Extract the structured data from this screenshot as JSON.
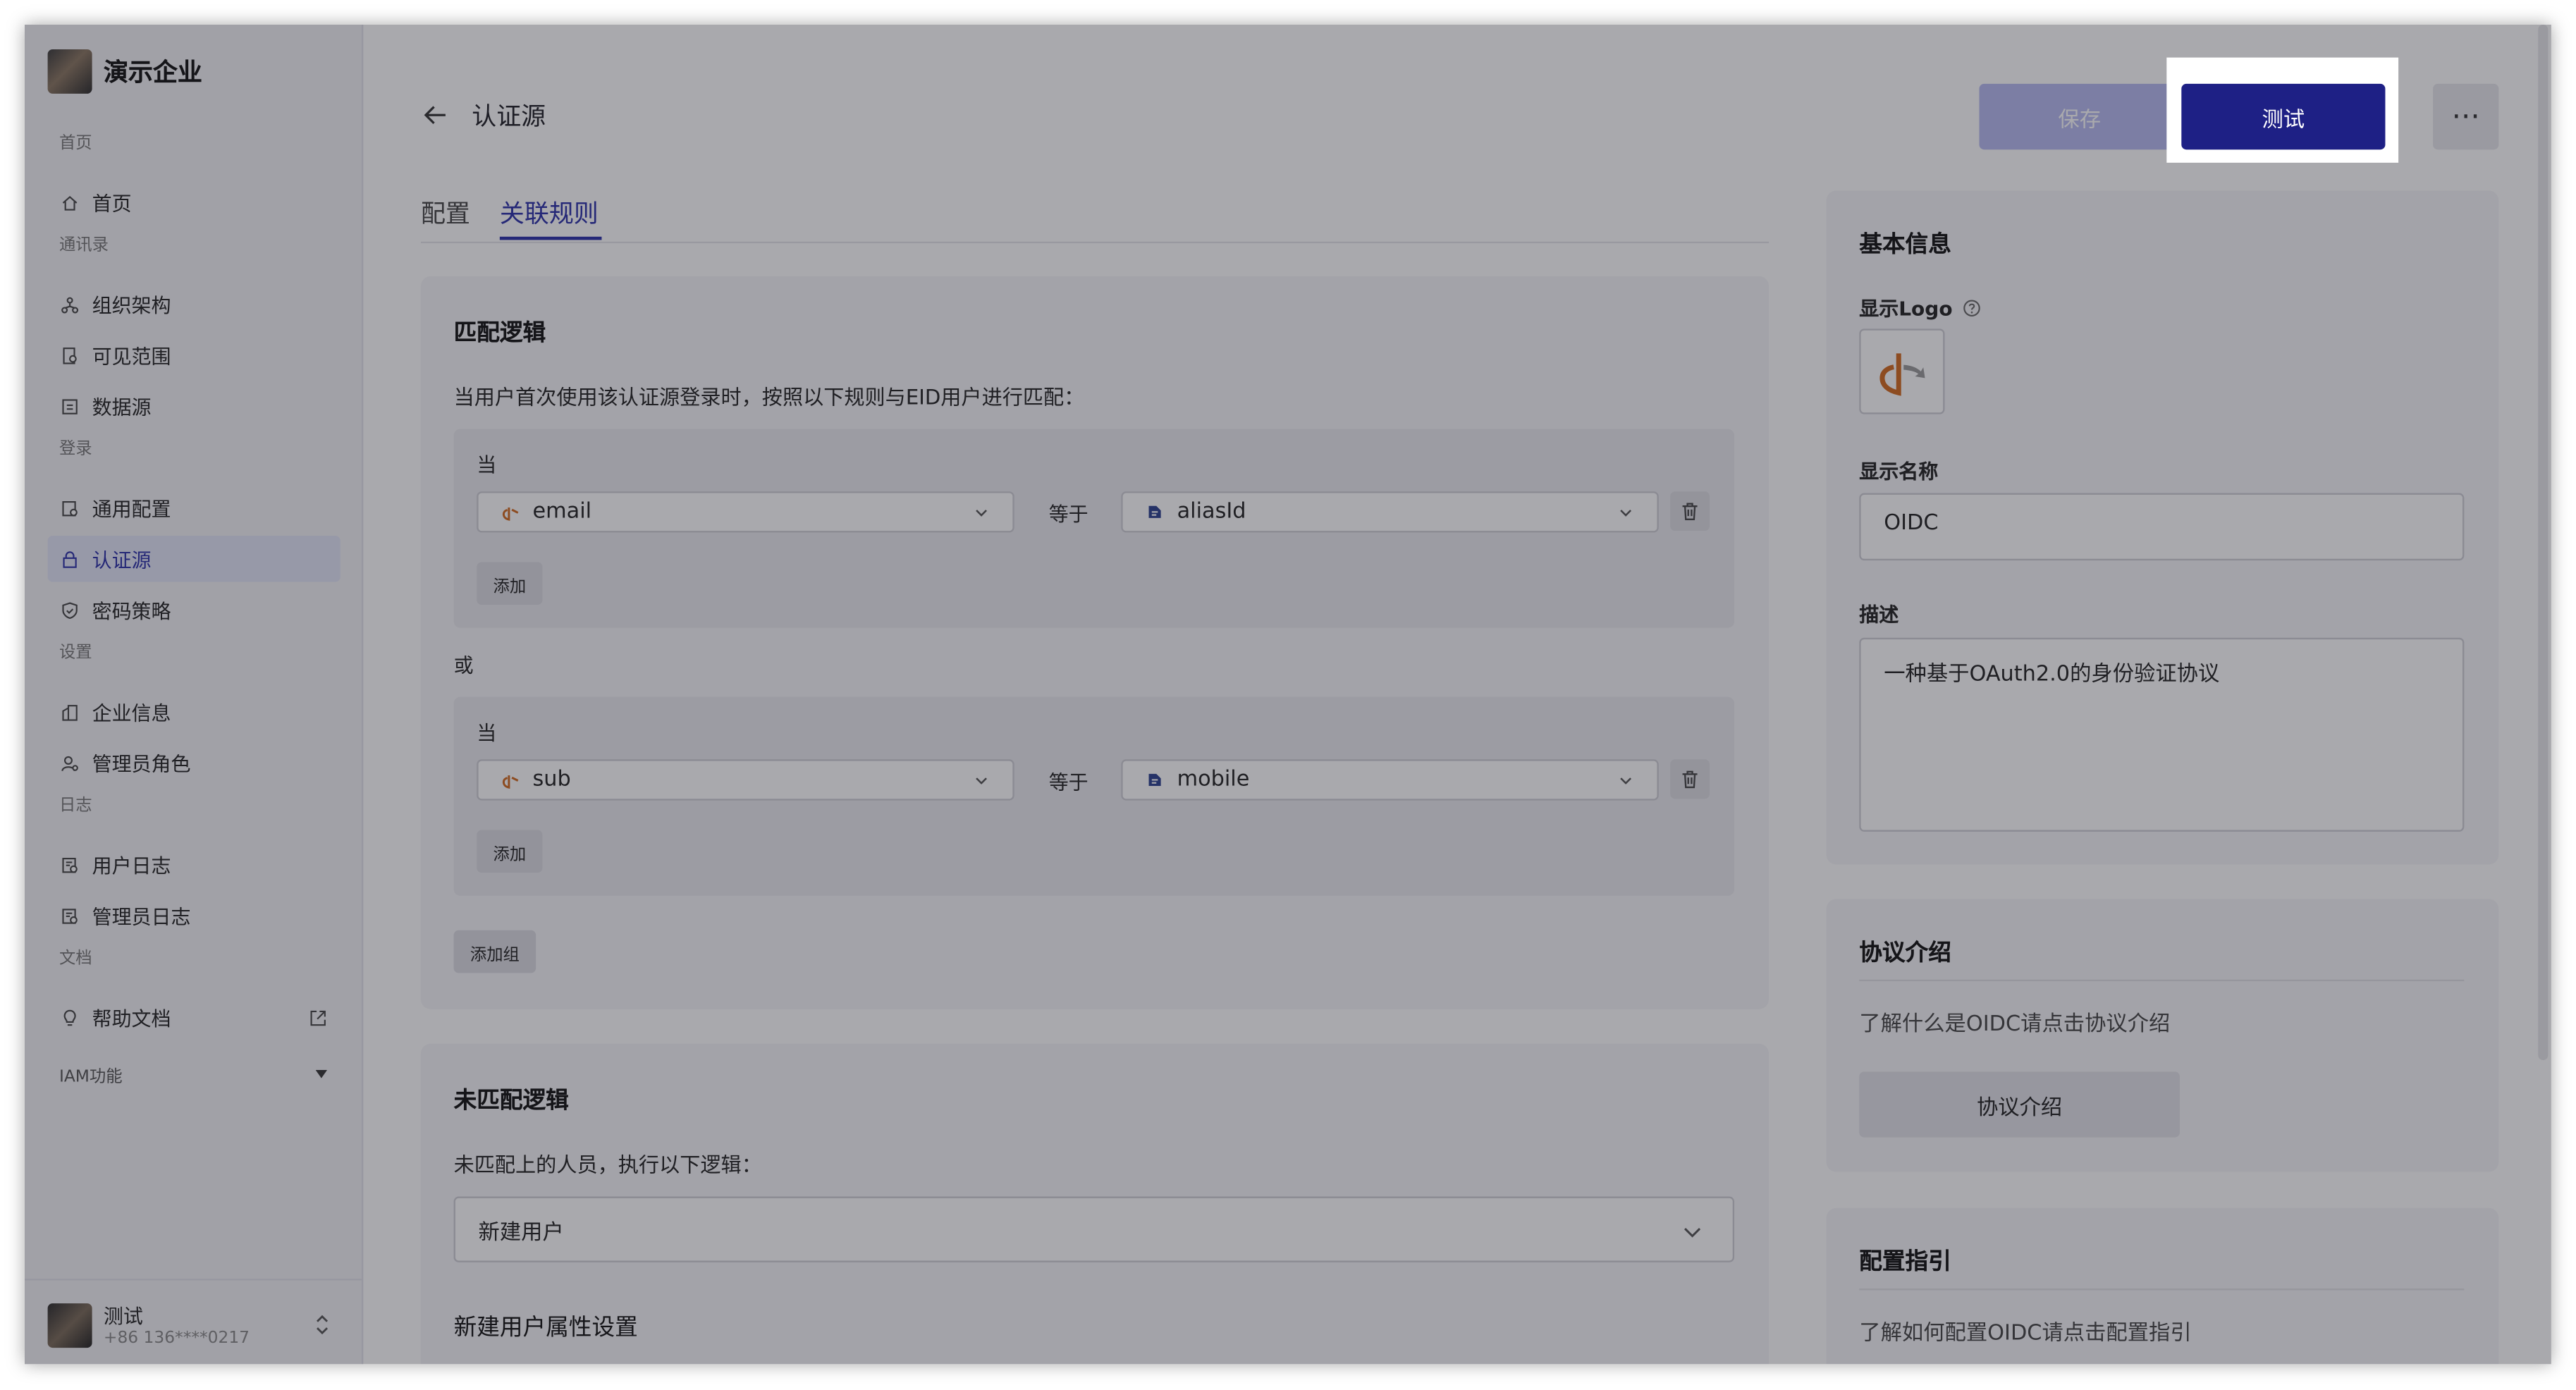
{
  "sidebar": {
    "brand": "演示企业",
    "groups": [
      {
        "title": "首页",
        "items": [
          {
            "label": "首页",
            "icon": "home-icon"
          }
        ]
      },
      {
        "title": "通讯录",
        "items": [
          {
            "label": "组织架构",
            "icon": "org-icon"
          },
          {
            "label": "可见范围",
            "icon": "scope-icon"
          },
          {
            "label": "数据源",
            "icon": "datasource-icon"
          }
        ]
      },
      {
        "title": "登录",
        "items": [
          {
            "label": "通用配置",
            "icon": "config-icon"
          },
          {
            "label": "认证源",
            "icon": "lock-icon",
            "active": true
          },
          {
            "label": "密码策略",
            "icon": "shield-icon"
          }
        ]
      },
      {
        "title": "设置",
        "items": [
          {
            "label": "企业信息",
            "icon": "building-icon"
          },
          {
            "label": "管理员角色",
            "icon": "admin-icon"
          }
        ]
      },
      {
        "title": "日志",
        "items": [
          {
            "label": "用户日志",
            "icon": "log-icon"
          },
          {
            "label": "管理员日志",
            "icon": "log-icon"
          }
        ]
      },
      {
        "title": "文档",
        "items": [
          {
            "label": "帮助文档",
            "icon": "bulb-icon",
            "external": true
          }
        ]
      }
    ],
    "iam_label": "IAM功能",
    "user": {
      "name": "测试",
      "phone": "+86 136****0217"
    }
  },
  "header": {
    "title": "认证源",
    "save_label": "保存",
    "test_label": "测试",
    "more_label": "···"
  },
  "tabs": [
    {
      "label": "配置"
    },
    {
      "label": "关联规则",
      "active": true
    }
  ],
  "match": {
    "title": "匹配逻辑",
    "desc": "当用户首次使用该认证源登录时，按照以下规则与EID用户进行匹配：",
    "or_label": "或",
    "when_label": "当",
    "equals_label": "等于",
    "add_label": "添加",
    "add_group_label": "添加组",
    "rules": [
      {
        "left": "email",
        "right": "aliasId"
      },
      {
        "left": "sub",
        "right": "mobile"
      }
    ]
  },
  "unmatched": {
    "title": "未匹配逻辑",
    "desc": "未匹配上的人员，执行以下逻辑：",
    "value": "新建用户",
    "attr_title": "新建用户属性设置"
  },
  "basic": {
    "title": "基本信息",
    "logo_label": "显示Logo",
    "name_label": "显示名称",
    "name_value": "OIDC",
    "desc_label": "描述",
    "desc_value": "一种基于OAuth2.0的身份验证协议"
  },
  "protocol": {
    "title": "协议介绍",
    "text": "了解什么是OIDC请点击协议介绍",
    "button": "协议介绍"
  },
  "guide": {
    "title": "配置指引",
    "text": "了解如何配置OIDC请点击配置指引"
  },
  "colors": {
    "accent": "#2a2fa8",
    "primary_button": "#1e2085",
    "oidc_orange": "#d2691e"
  }
}
